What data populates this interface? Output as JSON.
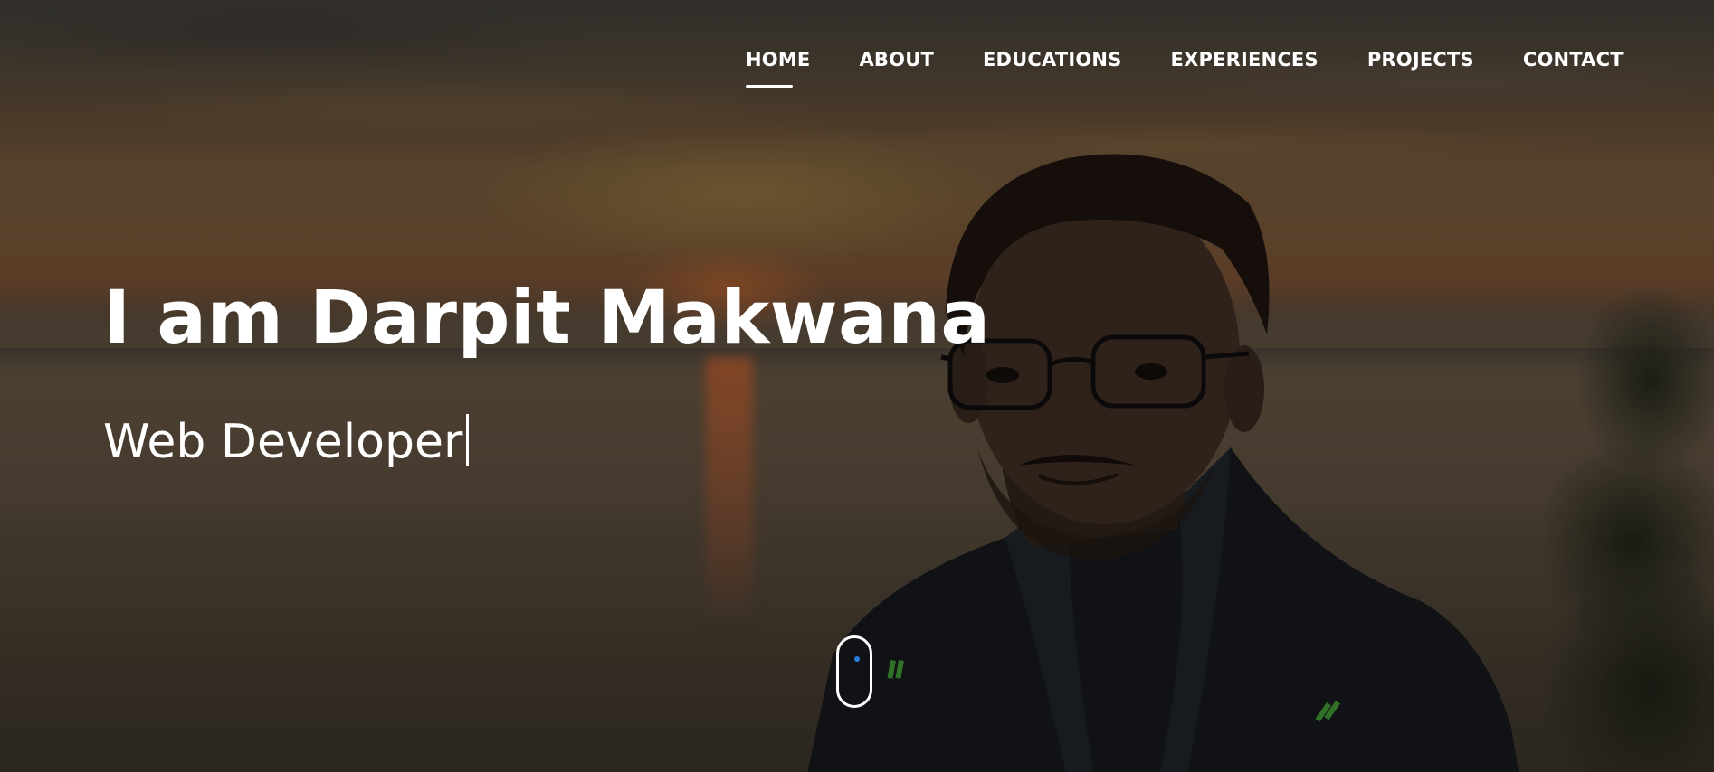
{
  "nav": {
    "items": [
      {
        "label": "HOME",
        "active": true
      },
      {
        "label": "ABOUT",
        "active": false
      },
      {
        "label": "EDUCATIONS",
        "active": false
      },
      {
        "label": "EXPERIENCES",
        "active": false
      },
      {
        "label": "PROJECTS",
        "active": false
      },
      {
        "label": "CONTACT",
        "active": false
      }
    ]
  },
  "hero": {
    "title": "I am Darpit Makwana",
    "subtitle": "Web Developer"
  },
  "scroll_indicator": {
    "icon": "mouse-scroll-icon",
    "dot_color": "#2a7fe0"
  },
  "colors": {
    "text": "#ffffff",
    "accent": "#2a7fe0"
  }
}
